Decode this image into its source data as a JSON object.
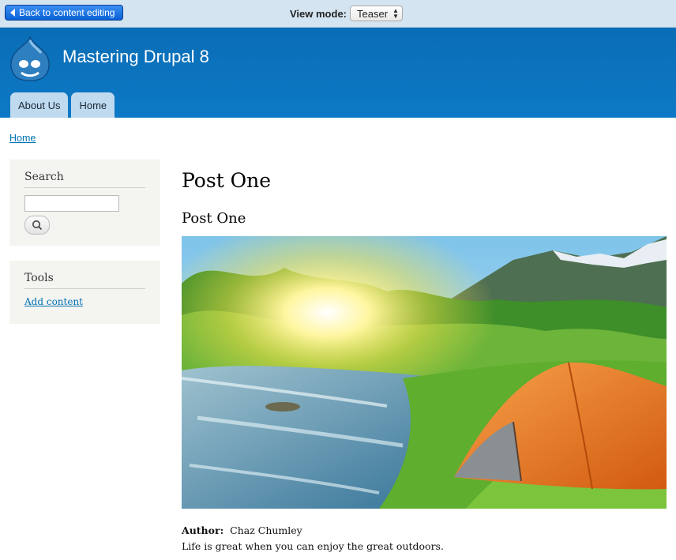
{
  "preview_bar": {
    "back_label": "Back to content editing",
    "view_mode_label": "View mode:",
    "view_mode_value": "Teaser"
  },
  "header": {
    "site_name": "Mastering Drupal 8",
    "nav": [
      {
        "label": "About Us"
      },
      {
        "label": "Home"
      }
    ]
  },
  "breadcrumb": {
    "home": "Home"
  },
  "sidebar": {
    "search": {
      "title": "Search",
      "input_value": "",
      "button_icon": "search-icon"
    },
    "tools": {
      "title": "Tools",
      "link": "Add content"
    }
  },
  "main": {
    "page_title": "Post One",
    "node_title": "Post One",
    "author_label": "Author:",
    "author_name": "Chaz Chumley",
    "summary": "Life is great when you can enjoy the great outdoors."
  },
  "colors": {
    "toolbar_bg": "#d4e4f1",
    "header_bg": "#0d79c6",
    "link": "#0071b3",
    "tab_bg": "#bfd9ee"
  }
}
